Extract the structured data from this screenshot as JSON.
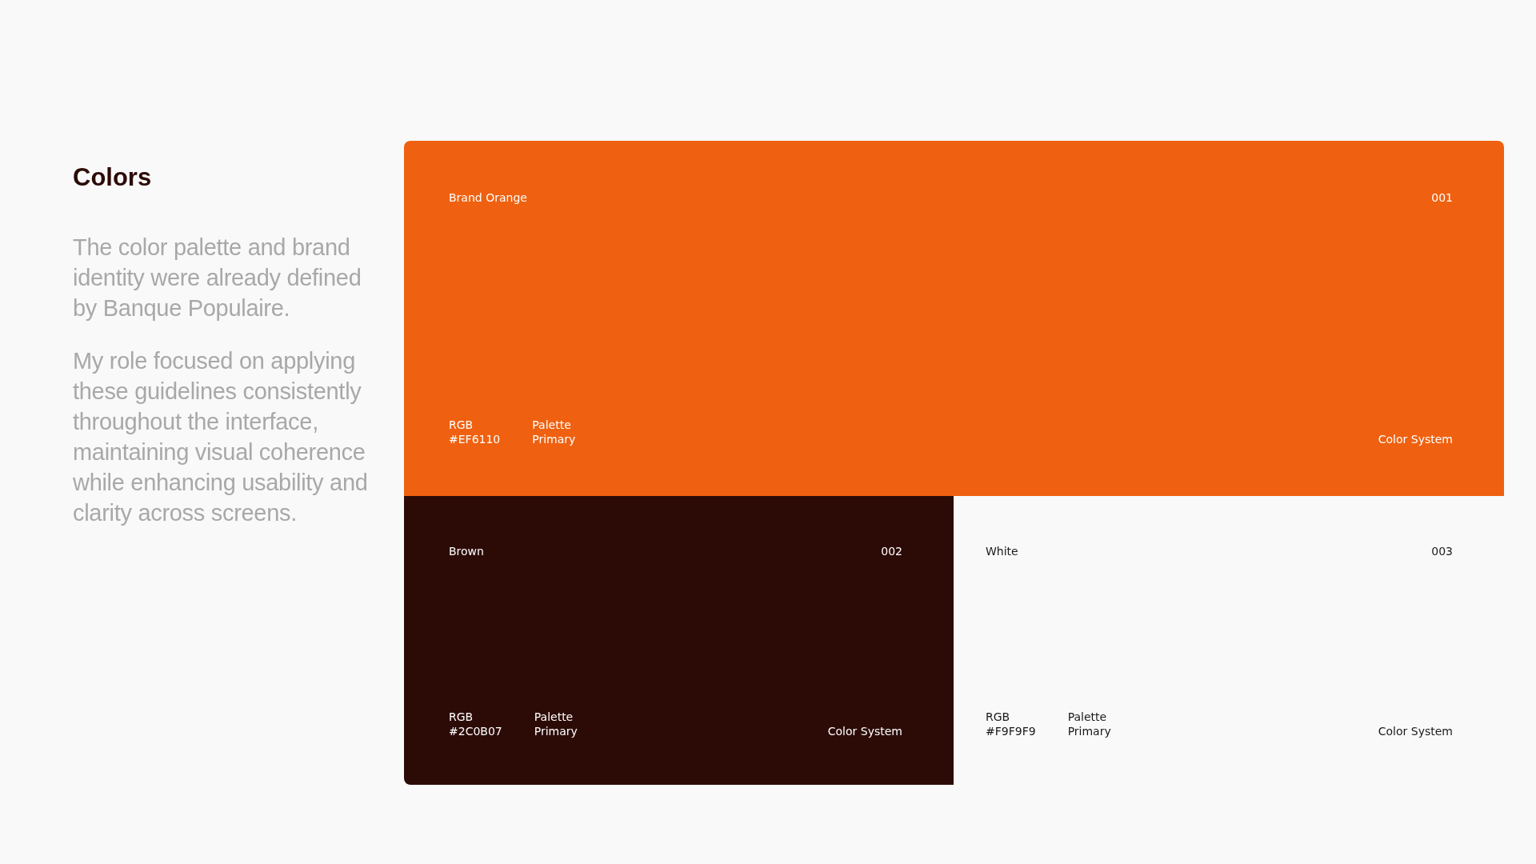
{
  "intro": {
    "title": "Colors",
    "paragraphs": [
      "The color palette and brand identity were already defined by Banque Populaire.",
      "My role focused on applying these guidelines consistently throughout the interface, maintaining visual coherence while enhancing usability and clarity across screens."
    ]
  },
  "swatches": [
    {
      "name": "Brand Orange",
      "number": "001",
      "color": "#ef6110",
      "rgb_label": "RGB",
      "hex": "#EF6110",
      "palette_label": "Palette",
      "palette": "Primary",
      "system": "Color System"
    },
    {
      "name": "Brown",
      "number": "002",
      "color": "#2c0b07",
      "rgb_label": "RGB",
      "hex": "#2C0B07",
      "palette_label": "Palette",
      "palette": "Primary",
      "system": "Color System"
    },
    {
      "name": "White",
      "number": "003",
      "color": "#f9f9f9",
      "rgb_label": "RGB",
      "hex": "#F9F9F9",
      "palette_label": "Palette",
      "palette": "Primary",
      "system": "Color System"
    }
  ]
}
